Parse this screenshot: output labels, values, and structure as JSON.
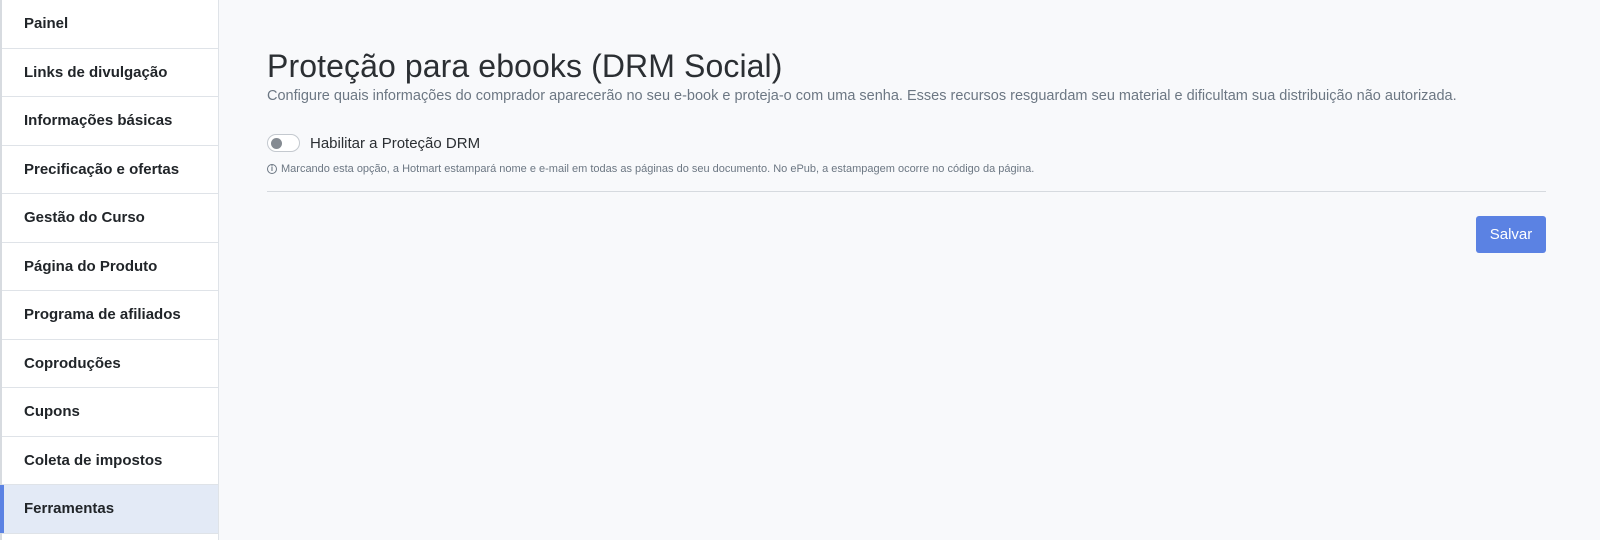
{
  "sidebar": {
    "items": [
      {
        "label": "Painel"
      },
      {
        "label": "Links de divulgação"
      },
      {
        "label": "Informações básicas"
      },
      {
        "label": "Precificação e ofertas"
      },
      {
        "label": "Gestão do Curso"
      },
      {
        "label": "Página do Produto"
      },
      {
        "label": "Programa de afiliados"
      },
      {
        "label": "Coproduções"
      },
      {
        "label": "Cupons"
      },
      {
        "label": "Coleta de impostos"
      },
      {
        "label": "Ferramentas"
      }
    ],
    "active_index": 10
  },
  "main": {
    "title": "Proteção para ebooks (DRM Social)",
    "subtitle": "Configure quais informações do comprador aparecerão no seu e-book e proteja-o com uma senha. Esses recursos resguardam seu material e dificultam sua distribuição não autorizada.",
    "drm_toggle": {
      "label": "Habilitar a Proteção DRM",
      "enabled": false
    },
    "hint_icon": "info-icon",
    "hint": "Marcando esta opção, a Hotmart estampará nome e e-mail em todas as páginas do seu documento. No ePub, a estampagem ocorre no código da página.",
    "save_label": "Salvar"
  },
  "colors": {
    "accent": "#5b82e3",
    "active_bg": "#e3eaf6",
    "page_bg": "#f8f9fb"
  }
}
